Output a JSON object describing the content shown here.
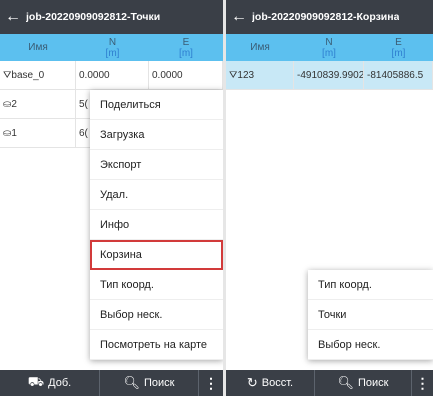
{
  "left": {
    "title": "job-20220909092812-Точки",
    "back_icon": "arrow-left-icon",
    "columns": [
      {
        "label": "Имя",
        "unit": ""
      },
      {
        "label": "N",
        "unit": "[m]"
      },
      {
        "label": "E",
        "unit": "[m]"
      }
    ],
    "rows": [
      {
        "icon": "⛛",
        "name": "base_0",
        "n": "0.0000",
        "e": "0.0000"
      },
      {
        "icon": "⛀",
        "name": "2",
        "n": "5(",
        "e": ""
      },
      {
        "icon": "⛀",
        "name": "1",
        "n": "6(",
        "e": ""
      }
    ],
    "menu": [
      "Поделиться",
      "Загрузка",
      "Экспорт",
      "Удал.",
      "Инфо",
      "Корзина",
      "Тип коорд.",
      "Выбор неск.",
      "Посмотреть на карте"
    ],
    "menu_highlighted": "Корзина",
    "bottom": {
      "add_label": "Доб.",
      "search_label": "Поиск",
      "more_label": "⋮"
    }
  },
  "right": {
    "title": "job-20220909092812-Корзина",
    "back_icon": "arrow-left-icon",
    "columns": [
      {
        "label": "Имя",
        "unit": ""
      },
      {
        "label": "N",
        "unit": "[m]"
      },
      {
        "label": "E",
        "unit": "[m]"
      }
    ],
    "rows": [
      {
        "icon": "⛛",
        "name": "123",
        "n": "-4910839.9902",
        "e": "-81405886.5"
      }
    ],
    "menu": [
      "Тип коорд.",
      "Точки",
      "Выбор неск."
    ],
    "bottom": {
      "restore_label": "Восст.",
      "search_label": "Поиск",
      "more_label": "⋮"
    }
  },
  "colors": {
    "appbar": "#3a3f47",
    "table_header": "#5cc0ef",
    "selected_row": "#c8e8f6",
    "highlight_outline": "#d23a3a"
  }
}
